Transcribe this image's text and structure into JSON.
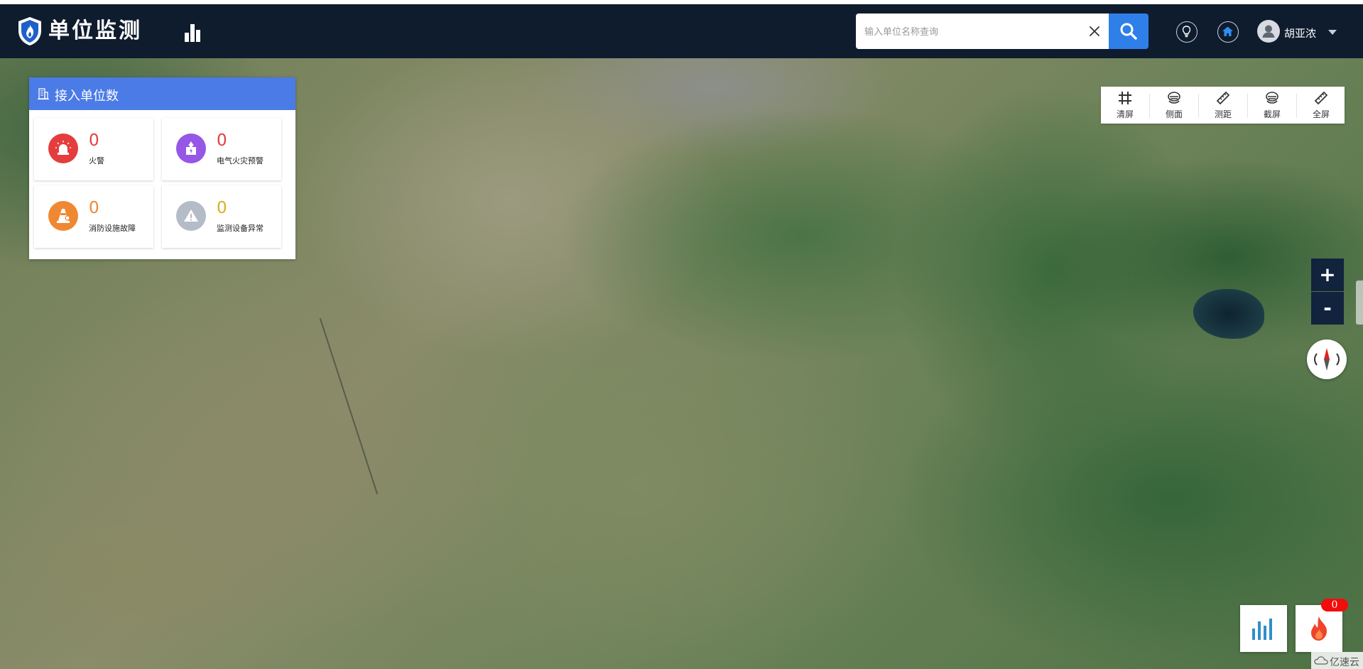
{
  "header": {
    "title": "单位监测",
    "search": {
      "placeholder": "输入单位名称查询",
      "value": ""
    },
    "user": {
      "name": "胡亚浓"
    }
  },
  "stats_panel": {
    "title": "接入单位数",
    "cards": [
      {
        "value": "0",
        "label": "火警",
        "color": "#e53d3d",
        "icon": "alarm-siren-icon"
      },
      {
        "value": "0",
        "label": "电气火灾预警",
        "color": "#9656e6",
        "icon": "electric-alert-icon"
      },
      {
        "value": "0",
        "label": "消防设施故障",
        "color": "#ef8833",
        "icon": "traffic-cone-icon"
      },
      {
        "value": "0",
        "label": "监测设备异常",
        "color": "#d7b11f",
        "icon": "warning-triangle-icon"
      }
    ]
  },
  "map_toolbar": {
    "items": [
      {
        "label": "清屏",
        "icon": "grid-icon"
      },
      {
        "label": "侧面",
        "icon": "layers-icon"
      },
      {
        "label": "测距",
        "icon": "ruler-icon"
      },
      {
        "label": "截屏",
        "icon": "layers-icon"
      },
      {
        "label": "全屏",
        "icon": "ruler-icon"
      }
    ]
  },
  "map_controls": {
    "zoom_in": "+",
    "zoom_out": "-"
  },
  "alarm_badge": {
    "count": "0"
  },
  "watermark": {
    "text": "亿速云"
  },
  "colors": {
    "header_bg": "#0f1c2e",
    "accent": "#2f7fe8",
    "panel_header": "#4b7be7",
    "zoom_bg": "#12233d",
    "badge": "#f20c0c"
  }
}
